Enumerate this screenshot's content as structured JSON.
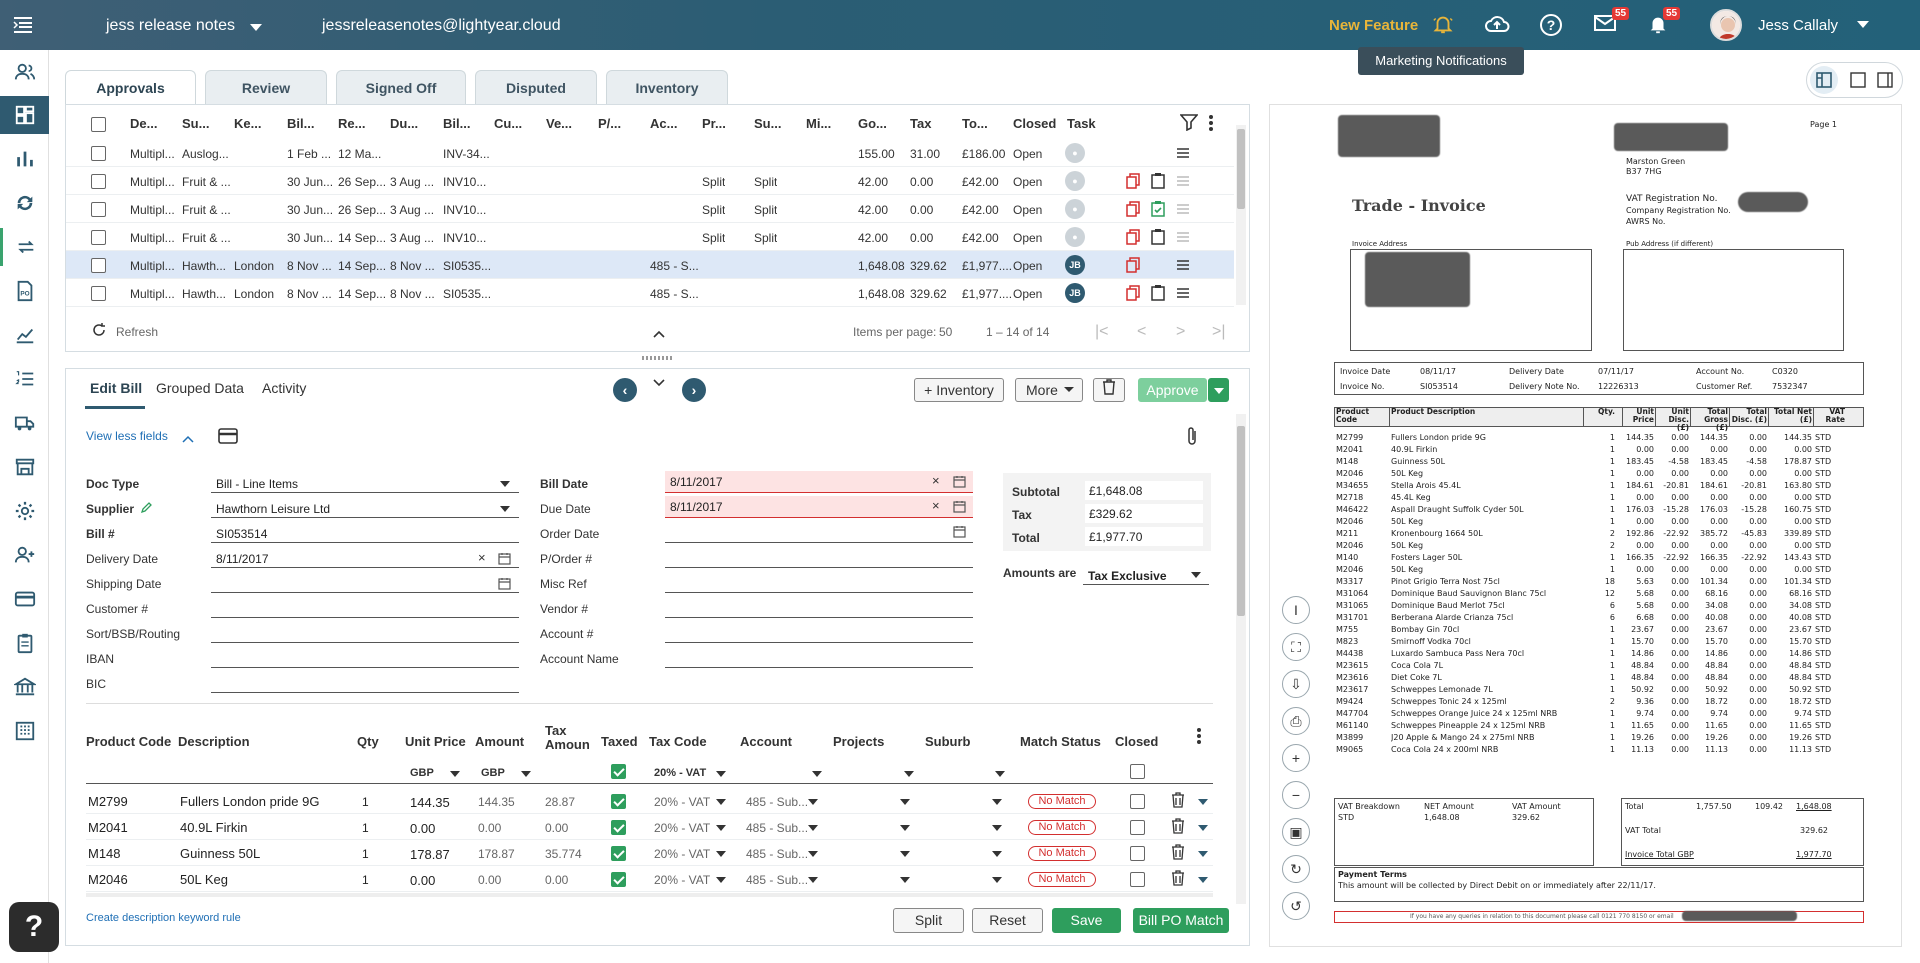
{
  "topbar": {
    "company": "jess release notes",
    "email": "jessreleasenotes@lightyear.cloud",
    "new_feature": "New Feature",
    "mail_badge": "55",
    "notif_badge": "55",
    "user": "Jess Callaly",
    "tooltip": "Marketing Notifications"
  },
  "tabs": [
    "Approvals",
    "Review",
    "Signed Off",
    "Disputed",
    "Inventory"
  ],
  "grid": {
    "headers": [
      "De...",
      "Su...",
      "Ke...",
      "Bil...",
      "Re...",
      "Du...",
      "Bil...",
      "Cu...",
      "Ve...",
      "P/...",
      "Ac...",
      "Pr...",
      "Su...",
      "Mi...",
      "Go...",
      "Tax",
      "To...",
      "Closed",
      "Task"
    ],
    "rows": [
      {
        "doc": "Multipl...",
        "supplier": "Auslog...",
        "key": "",
        "bill_date": "1 Feb ...",
        "rec": "12 Ma...",
        "due": "",
        "bill_no": "INV-34...",
        "acct": "",
        "proj": "",
        "sub": "",
        "gross": "155.00",
        "tax": "31.00",
        "total": "£186.00",
        "closed": "Open",
        "task": ""
      },
      {
        "doc": "Multipl...",
        "supplier": "Fruit & ...",
        "key": "",
        "bill_date": "30 Jun...",
        "rec": "26 Sep...",
        "due": "3 Aug ...",
        "bill_no": "INV10...",
        "acct": "",
        "proj": "Split",
        "sub": "Split",
        "gross": "42.00",
        "tax": "0.00",
        "total": "£42.00",
        "closed": "Open",
        "task": ""
      },
      {
        "doc": "Multipl...",
        "supplier": "Fruit & ...",
        "key": "",
        "bill_date": "30 Jun...",
        "rec": "26 Sep...",
        "due": "3 Aug ...",
        "bill_no": "INV10...",
        "acct": "",
        "proj": "Split",
        "sub": "Split",
        "gross": "42.00",
        "tax": "0.00",
        "total": "£42.00",
        "closed": "Open",
        "task": ""
      },
      {
        "doc": "Multipl...",
        "supplier": "Fruit & ...",
        "key": "",
        "bill_date": "30 Jun...",
        "rec": "14 Sep...",
        "due": "3 Aug ...",
        "bill_no": "INV10...",
        "acct": "",
        "proj": "Split",
        "sub": "Split",
        "gross": "42.00",
        "tax": "0.00",
        "total": "£42.00",
        "closed": "Open",
        "task": ""
      },
      {
        "doc": "Multipl...",
        "supplier": "Hawth...",
        "key": "London",
        "bill_date": "8 Nov ...",
        "rec": "14 Sep...",
        "due": "8 Nov ...",
        "bill_no": "SI0535...",
        "acct": "485 - S...",
        "proj": "",
        "sub": "",
        "gross": "1,648.08",
        "tax": "329.62",
        "total": "£1,977....",
        "closed": "Open",
        "task": "JB"
      },
      {
        "doc": "Multipl...",
        "supplier": "Hawth...",
        "key": "London",
        "bill_date": "8 Nov ...",
        "rec": "14 Sep...",
        "due": "8 Nov ...",
        "bill_no": "SI0535...",
        "acct": "485 - S...",
        "proj": "",
        "sub": "",
        "gross": "1,648.08",
        "tax": "329.62",
        "total": "£1,977....",
        "closed": "Open",
        "task": "JB"
      }
    ],
    "refresh": "Refresh",
    "items_per_page_label": "Items per page:",
    "items_per_page": "50",
    "range": "1 – 14 of 14"
  },
  "edit": {
    "tabs": [
      "Edit Bill",
      "Grouped Data",
      "Activity"
    ],
    "inventory_btn": "+ Inventory",
    "more_btn": "More",
    "approve_btn": "Approve",
    "view_less": "View less fields",
    "fields_left": [
      {
        "label": "Doc Type",
        "value": "Bill - Line Items",
        "bold": true
      },
      {
        "label": "Supplier",
        "value": "Hawthorn Leisure Ltd",
        "bold": true
      },
      {
        "label": "Bill #",
        "value": "SI053514",
        "bold": true
      },
      {
        "label": "Delivery Date",
        "value": "8/11/2017",
        "bold": false
      },
      {
        "label": "Shipping Date",
        "value": "",
        "bold": false
      },
      {
        "label": "Customer #",
        "value": "",
        "bold": false
      },
      {
        "label": "Sort/BSB/Routing",
        "value": "",
        "bold": false
      },
      {
        "label": "IBAN",
        "value": "",
        "bold": false
      },
      {
        "label": "BIC",
        "value": "",
        "bold": false
      }
    ],
    "fields_mid": [
      {
        "label": "Bill Date",
        "value": "8/11/2017",
        "bold": true
      },
      {
        "label": "Due Date",
        "value": "8/11/2017",
        "bold": false
      },
      {
        "label": "Order Date",
        "value": "",
        "bold": false
      },
      {
        "label": "P/Order #",
        "value": "",
        "bold": false
      },
      {
        "label": "Misc Ref",
        "value": "",
        "bold": false
      },
      {
        "label": "Vendor #",
        "value": "",
        "bold": false
      },
      {
        "label": "Account #",
        "value": "",
        "bold": false
      },
      {
        "label": "Account Name",
        "value": "",
        "bold": false
      }
    ],
    "subtotal_label": "Subtotal",
    "subtotal": "£1,648.08",
    "tax_label": "Tax",
    "tax": "£329.62",
    "total_label": "Total",
    "total": "£1,977.70",
    "amounts_are_label": "Amounts are",
    "amounts_are": "Tax Exclusive"
  },
  "lines": {
    "headers": [
      "Product Code",
      "Description",
      "Qty",
      "Unit Price",
      "Amount",
      "Tax Amoun",
      "Taxed",
      "Tax Code",
      "Account",
      "Projects",
      "Suburb",
      "Match Status",
      "Closed"
    ],
    "currency": "GBP",
    "tax_code_default": "20% - VAT",
    "rows": [
      {
        "code": "M2799",
        "desc": "Fullers London pride 9G",
        "qty": "1",
        "unit": "144.35",
        "amount": "144.35",
        "tax": "28.87",
        "taxcode": "20% - VAT",
        "account": "485 - Sub...",
        "status": "No Match"
      },
      {
        "code": "M2041",
        "desc": "40.9L Firkin",
        "qty": "1",
        "unit": "0.00",
        "amount": "0.00",
        "tax": "0.00",
        "taxcode": "20% - VAT",
        "account": "485 - Sub...",
        "status": "No Match"
      },
      {
        "code": "M148",
        "desc": "Guinness  50L",
        "qty": "1",
        "unit": "178.87",
        "amount": "178.87",
        "tax": "35.774",
        "taxcode": "20% - VAT",
        "account": "485 - Sub...",
        "status": "No Match"
      },
      {
        "code": "M2046",
        "desc": "50L Keg",
        "qty": "1",
        "unit": "0.00",
        "amount": "0.00",
        "tax": "0.00",
        "taxcode": "20% - VAT",
        "account": "485 - Sub...",
        "status": "No Match"
      }
    ],
    "keyword_link": "Create description keyword rule",
    "split_btn": "Split",
    "reset_btn": "Reset",
    "save_btn": "Save",
    "bill_po_btn": "Bill PO Match"
  },
  "invoice": {
    "page": "Page  1",
    "addr1": "Marston Green",
    "addr2": "B37 7HG",
    "title": "Trade - Invoice",
    "vat_reg": "VAT Registration No.",
    "company_reg": "Company Registration No.",
    "awrs": "AWRS No.",
    "invoice_address": "Invoice Address",
    "pub_address": "Pub Address (if different)",
    "inv_date_label": "Invoice Date",
    "inv_date": "08/11/17",
    "inv_no_label": "Invoice No.",
    "inv_no": "SI053514",
    "del_date_label": "Delivery Date",
    "del_date": "07/11/17",
    "del_note_label": "Delivery Note No.",
    "del_note": "12226313",
    "acct_label": "Account No.",
    "acct": "C0320",
    "cust_ref_label": "Customer Ref.",
    "cust_ref": "7532347",
    "headers": [
      "Product Code",
      "Product Description",
      "Qty.",
      "Unit Price",
      "Unit Disc. (£)",
      "Total Gross (£)",
      "Total Disc. (£)",
      "Total Net (£)",
      "VAT Rate"
    ],
    "items": [
      [
        "M2799",
        "Fullers London pride 9G",
        "1",
        "144.35",
        "0.00",
        "144.35",
        "0.00",
        "144.35",
        "STD"
      ],
      [
        "M2041",
        "40.9L Firkin",
        "1",
        "0.00",
        "0.00",
        "0.00",
        "0.00",
        "0.00",
        "STD"
      ],
      [
        "M148",
        "Guinness  50L",
        "1",
        "183.45",
        "-4.58",
        "183.45",
        "-4.58",
        "178.87",
        "STD"
      ],
      [
        "M2046",
        "50L Keg",
        "1",
        "0.00",
        "0.00",
        "0.00",
        "0.00",
        "0.00",
        "STD"
      ],
      [
        "M34655",
        "Stella Arois  45.4L",
        "1",
        "184.61",
        "-20.81",
        "184.61",
        "-20.81",
        "163.80",
        "STD"
      ],
      [
        "M2718",
        "45.4L Keg",
        "1",
        "0.00",
        "0.00",
        "0.00",
        "0.00",
        "0.00",
        "STD"
      ],
      [
        "M46422",
        "Aspall Draught Suffolk Cyder 50L",
        "1",
        "176.03",
        "-15.28",
        "176.03",
        "-15.28",
        "160.75",
        "STD"
      ],
      [
        "M2046",
        "50L Keg",
        "1",
        "0.00",
        "0.00",
        "0.00",
        "0.00",
        "0.00",
        "STD"
      ],
      [
        "M211",
        "Kronenbourg 1664  50L",
        "2",
        "192.86",
        "-22.92",
        "385.72",
        "-45.83",
        "339.89",
        "STD"
      ],
      [
        "M2046",
        "50L Keg",
        "2",
        "0.00",
        "0.00",
        "0.00",
        "0.00",
        "0.00",
        "STD"
      ],
      [
        "M140",
        "Fosters Lager  50L",
        "1",
        "166.35",
        "-22.92",
        "166.35",
        "-22.92",
        "143.43",
        "STD"
      ],
      [
        "M2046",
        "50L Keg",
        "1",
        "0.00",
        "0.00",
        "0.00",
        "0.00",
        "0.00",
        "STD"
      ],
      [
        "M3317",
        "Pinot Grigio Terra Nost  75cl",
        "18",
        "5.63",
        "0.00",
        "101.34",
        "0.00",
        "101.34",
        "STD"
      ],
      [
        "M31064",
        "Dominique Baud Sauvignon Blanc  75cl",
        "12",
        "5.68",
        "0.00",
        "68.16",
        "0.00",
        "68.16",
        "STD"
      ],
      [
        "M31065",
        "Dominique Baud Merlot  75cl",
        "6",
        "5.68",
        "0.00",
        "34.08",
        "0.00",
        "34.08",
        "STD"
      ],
      [
        "M31701",
        "Berberana Alarde Crianza  75cl",
        "6",
        "6.68",
        "0.00",
        "40.08",
        "0.00",
        "40.08",
        "STD"
      ],
      [
        "M755",
        "Bombay Gin  70cl",
        "1",
        "23.67",
        "0.00",
        "23.67",
        "0.00",
        "23.67",
        "STD"
      ],
      [
        "M823",
        "Smirnoff Vodka  70cl",
        "1",
        "15.70",
        "0.00",
        "15.70",
        "0.00",
        "15.70",
        "STD"
      ],
      [
        "M4438",
        "Luxardo Sambuca Pass Nera  70cl",
        "1",
        "14.86",
        "0.00",
        "14.86",
        "0.00",
        "14.86",
        "STD"
      ],
      [
        "M23615",
        "Coca Cola  7L",
        "1",
        "48.84",
        "0.00",
        "48.84",
        "0.00",
        "48.84",
        "STD"
      ],
      [
        "M23616",
        "Diet Coke  7L",
        "1",
        "48.84",
        "0.00",
        "48.84",
        "0.00",
        "48.84",
        "STD"
      ],
      [
        "M23617",
        "Schweppes Lemonade  7L",
        "1",
        "50.92",
        "0.00",
        "50.92",
        "0.00",
        "50.92",
        "STD"
      ],
      [
        "M9424",
        "Schweppes Tonic 24 x 125ml",
        "2",
        "9.36",
        "0.00",
        "18.72",
        "0.00",
        "18.72",
        "STD"
      ],
      [
        "M47704",
        "Schweppes Orange Juice  24 x 125ml NRB",
        "1",
        "9.74",
        "0.00",
        "9.74",
        "0.00",
        "9.74",
        "STD"
      ],
      [
        "M61140",
        "Schweppes Pineapple  24 x 125ml NRB",
        "1",
        "11.65",
        "0.00",
        "11.65",
        "0.00",
        "11.65",
        "STD"
      ],
      [
        "M3899",
        "J20 Apple & Mango  24 x 275ml NRB",
        "1",
        "19.26",
        "0.00",
        "19.26",
        "0.00",
        "19.26",
        "STD"
      ],
      [
        "M9065",
        "Coca Cola  24 x 200ml NRB",
        "1",
        "11.13",
        "0.00",
        "11.13",
        "0.00",
        "11.13",
        "STD"
      ]
    ],
    "vat_breakdown": "VAT Breakdown",
    "net_amount": "NET Amount",
    "vat_amount": "VAT Amount",
    "std": "STD",
    "vb_net": "1,648.08",
    "vb_vat": "329.62",
    "total_label": "Total",
    "tot_a": "1,757.50",
    "tot_b": "109.42",
    "tot_c": "1,648.08",
    "vat_total_label": "VAT Total",
    "vat_total": "329.62",
    "inv_total_label": "Invoice Total GBP",
    "inv_total": "1,977.70",
    "payment_terms": "Payment Terms",
    "payment_text": "This amount will be collected by Direct Debit  on or immediately after 22/11/17.",
    "footer": "If you have any queries in relation to this document please call 0121 770 8150 or email"
  }
}
